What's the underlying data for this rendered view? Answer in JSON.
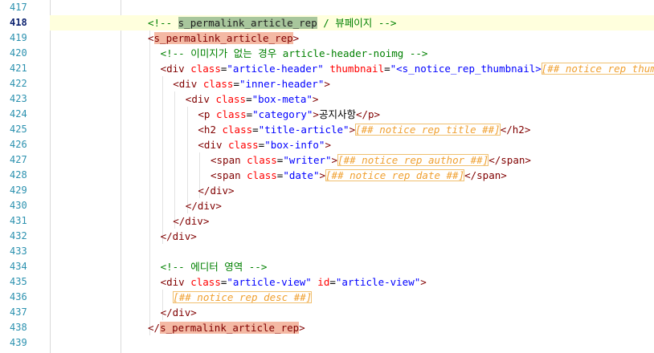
{
  "editor": {
    "active_line": "418",
    "lines": [
      {
        "num": "417",
        "segments": []
      },
      {
        "num": "418",
        "segments": [
          {
            "t": "<!-- ",
            "c": "c-comment"
          },
          {
            "t": "s_permalink_article_rep",
            "c": "c-hl-green"
          },
          {
            "t": " / 뷰페이지 -->",
            "c": "c-comment"
          }
        ]
      },
      {
        "num": "419",
        "segments": [
          {
            "t": "<",
            "c": "c-tag"
          },
          {
            "t": "s_permalink_article_rep",
            "c": "c-hl-tag"
          },
          {
            "t": ">",
            "c": "c-tag"
          }
        ]
      },
      {
        "num": "420",
        "segments": [
          {
            "t": "<!-- 이미지가 없는 경우 article-header-noimg -->",
            "c": "c-comment"
          }
        ]
      },
      {
        "num": "421",
        "segments": [
          {
            "t": "<div ",
            "c": "c-tag"
          },
          {
            "t": "class",
            "c": "c-attr"
          },
          {
            "t": "=",
            "c": "c-text"
          },
          {
            "t": "\"article-header\"",
            "c": "c-val"
          },
          {
            "t": " ",
            "c": "c-text"
          },
          {
            "t": "thumbnail",
            "c": "c-attr"
          },
          {
            "t": "=",
            "c": "c-text"
          },
          {
            "t": "\"<s_notice_rep_thumbnail>",
            "c": "c-val"
          },
          {
            "t": "[##_notice_rep_thumbnail_url_##]",
            "c": "c-var"
          }
        ]
      },
      {
        "num": "422",
        "segments": [
          {
            "t": "<div ",
            "c": "c-tag"
          },
          {
            "t": "class",
            "c": "c-attr"
          },
          {
            "t": "=",
            "c": "c-text"
          },
          {
            "t": "\"inner-header\"",
            "c": "c-val"
          },
          {
            "t": ">",
            "c": "c-tag"
          }
        ]
      },
      {
        "num": "423",
        "segments": [
          {
            "t": "<div ",
            "c": "c-tag"
          },
          {
            "t": "class",
            "c": "c-attr"
          },
          {
            "t": "=",
            "c": "c-text"
          },
          {
            "t": "\"box-meta\"",
            "c": "c-val"
          },
          {
            "t": ">",
            "c": "c-tag"
          }
        ]
      },
      {
        "num": "424",
        "segments": [
          {
            "t": "<p ",
            "c": "c-tag"
          },
          {
            "t": "class",
            "c": "c-attr"
          },
          {
            "t": "=",
            "c": "c-text"
          },
          {
            "t": "\"category\"",
            "c": "c-val"
          },
          {
            "t": ">",
            "c": "c-tag"
          },
          {
            "t": "공지사항",
            "c": "c-text"
          },
          {
            "t": "</p>",
            "c": "c-tag"
          }
        ]
      },
      {
        "num": "425",
        "segments": [
          {
            "t": "<h2 ",
            "c": "c-tag"
          },
          {
            "t": "class",
            "c": "c-attr"
          },
          {
            "t": "=",
            "c": "c-text"
          },
          {
            "t": "\"title-article\"",
            "c": "c-val"
          },
          {
            "t": ">",
            "c": "c-tag"
          },
          {
            "t": "[##_notice_rep_title_##]",
            "c": "c-var"
          },
          {
            "t": "</h2>",
            "c": "c-tag"
          }
        ]
      },
      {
        "num": "426",
        "segments": [
          {
            "t": "<div ",
            "c": "c-tag"
          },
          {
            "t": "class",
            "c": "c-attr"
          },
          {
            "t": "=",
            "c": "c-text"
          },
          {
            "t": "\"box-info\"",
            "c": "c-val"
          },
          {
            "t": ">",
            "c": "c-tag"
          }
        ]
      },
      {
        "num": "427",
        "segments": [
          {
            "t": "<span ",
            "c": "c-tag"
          },
          {
            "t": "class",
            "c": "c-attr"
          },
          {
            "t": "=",
            "c": "c-text"
          },
          {
            "t": "\"writer\"",
            "c": "c-val"
          },
          {
            "t": ">",
            "c": "c-tag"
          },
          {
            "t": "[##_notice_rep_author_##]",
            "c": "c-var"
          },
          {
            "t": "</span>",
            "c": "c-tag"
          }
        ]
      },
      {
        "num": "428",
        "segments": [
          {
            "t": "<span ",
            "c": "c-tag"
          },
          {
            "t": "class",
            "c": "c-attr"
          },
          {
            "t": "=",
            "c": "c-text"
          },
          {
            "t": "\"date\"",
            "c": "c-val"
          },
          {
            "t": ">",
            "c": "c-tag"
          },
          {
            "t": "[##_notice_rep_date_##]",
            "c": "c-var"
          },
          {
            "t": "</span>",
            "c": "c-tag"
          }
        ]
      },
      {
        "num": "429",
        "segments": [
          {
            "t": "</div>",
            "c": "c-tag"
          }
        ]
      },
      {
        "num": "430",
        "segments": [
          {
            "t": "</div>",
            "c": "c-tag"
          }
        ]
      },
      {
        "num": "431",
        "segments": [
          {
            "t": "</div>",
            "c": "c-tag"
          }
        ]
      },
      {
        "num": "432",
        "segments": [
          {
            "t": "</div>",
            "c": "c-tag"
          }
        ]
      },
      {
        "num": "433",
        "segments": []
      },
      {
        "num": "434",
        "segments": [
          {
            "t": "<!-- 에디터 영역 -->",
            "c": "c-comment"
          }
        ]
      },
      {
        "num": "435",
        "segments": [
          {
            "t": "<div ",
            "c": "c-tag"
          },
          {
            "t": "class",
            "c": "c-attr"
          },
          {
            "t": "=",
            "c": "c-text"
          },
          {
            "t": "\"article-view\"",
            "c": "c-val"
          },
          {
            "t": " ",
            "c": "c-text"
          },
          {
            "t": "id",
            "c": "c-attr"
          },
          {
            "t": "=",
            "c": "c-text"
          },
          {
            "t": "\"article-view\"",
            "c": "c-val"
          },
          {
            "t": ">",
            "c": "c-tag"
          }
        ]
      },
      {
        "num": "436",
        "segments": [
          {
            "t": "[##_notice_rep_desc_##]",
            "c": "c-var"
          }
        ]
      },
      {
        "num": "437",
        "segments": [
          {
            "t": "</div>",
            "c": "c-tag"
          }
        ]
      },
      {
        "num": "438",
        "segments": [
          {
            "t": "</",
            "c": "c-tag"
          },
          {
            "t": "s_permalink_article_rep",
            "c": "c-hl-tag2"
          },
          {
            "t": ">",
            "c": "c-tag"
          }
        ]
      },
      {
        "num": "439",
        "segments": []
      }
    ]
  }
}
